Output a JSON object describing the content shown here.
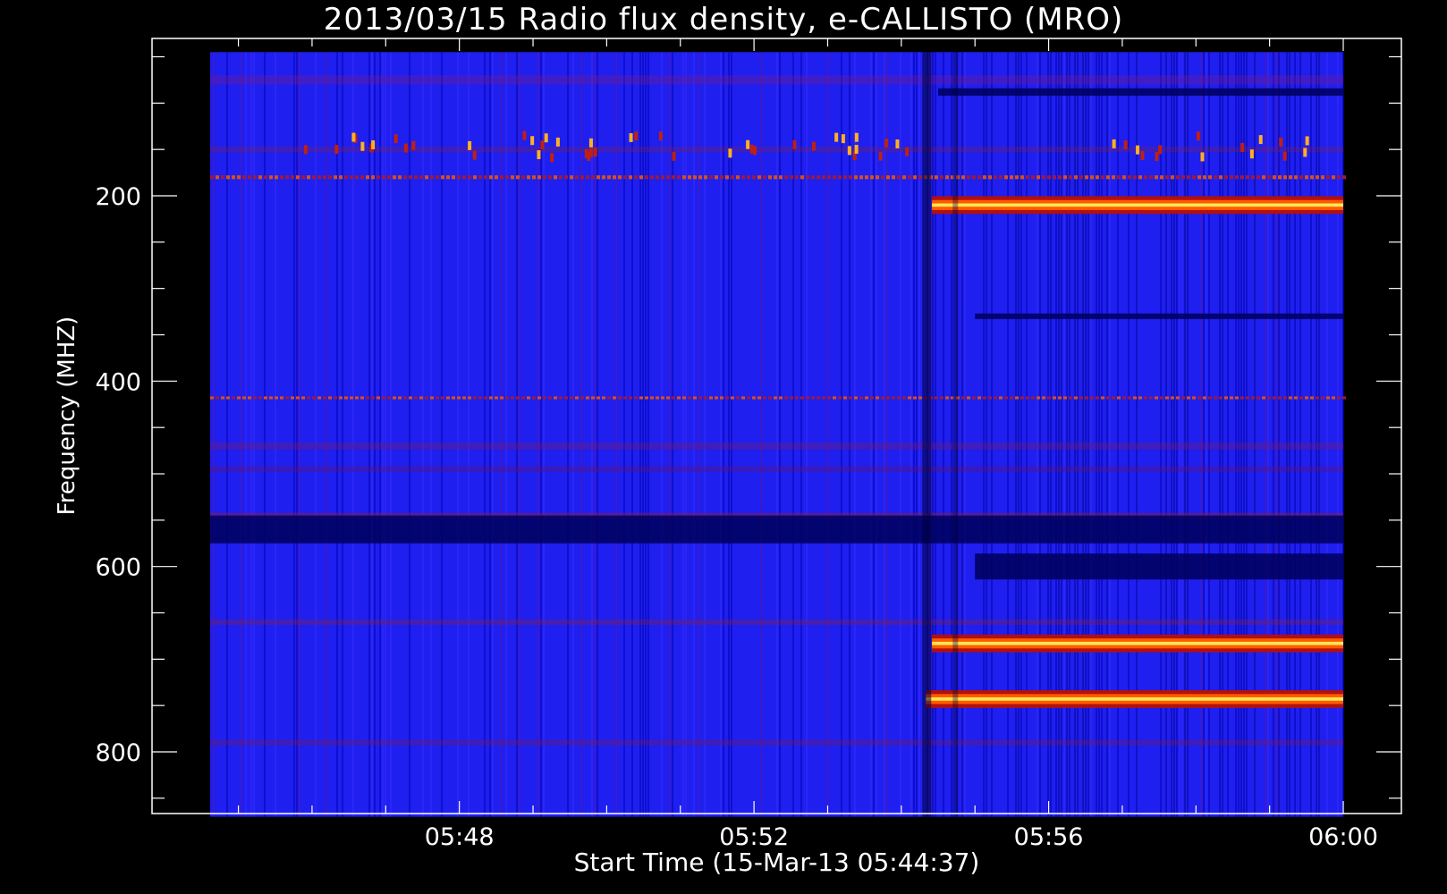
{
  "chart_data": {
    "type": "heatmap",
    "title": "2013/03/15  Radio flux density, e-CALLISTO (MRO)",
    "xlabel": "Start Time (15-Mar-13 05:44:37)",
    "ylabel": "Frequency (MHZ)",
    "x_ticks": [
      "05:48",
      "05:52",
      "05:56",
      "06:00"
    ],
    "y_ticks": [
      "200",
      "400",
      "600",
      "800"
    ],
    "xlim": [
      "05:44:37",
      "06:00:00"
    ],
    "ylim": [
      870,
      20
    ],
    "y_inverted": true,
    "data_extent_freq": [
      45,
      870
    ],
    "grid": false,
    "colormap": [
      "#000000",
      "#00007a",
      "#0000ff",
      "#5a0f9a",
      "#c01a10",
      "#ff5000",
      "#ffff60"
    ],
    "background_color": "#1f1ff0",
    "event_onset_time": "05:54:20",
    "features": [
      {
        "kind": "band",
        "freq": 210,
        "width": 12,
        "t_start": "05:54:25",
        "t_end": "06:00:00",
        "intensity": "high"
      },
      {
        "kind": "band",
        "freq": 683,
        "width": 12,
        "t_start": "05:54:25",
        "t_end": "06:00:00",
        "intensity": "high"
      },
      {
        "kind": "band",
        "freq": 743,
        "width": 12,
        "t_start": "05:54:20",
        "t_end": "06:00:00",
        "intensity": "high"
      },
      {
        "kind": "band",
        "freq": 180,
        "width": 4,
        "t_start": "05:44:37",
        "t_end": "06:00:00",
        "intensity": "medium"
      },
      {
        "kind": "band",
        "freq": 418,
        "width": 3,
        "t_start": "05:44:37",
        "t_end": "06:00:00",
        "intensity": "medium"
      },
      {
        "kind": "band",
        "freq": 88,
        "width": 8,
        "t_start": "05:54:30",
        "t_end": "06:00:00",
        "intensity": "dark"
      },
      {
        "kind": "band",
        "freq": 560,
        "width": 30,
        "t_start": "05:44:37",
        "t_end": "06:00:00",
        "intensity": "dark"
      },
      {
        "kind": "band",
        "freq": 600,
        "width": 28,
        "t_start": "05:55:00",
        "t_end": "06:00:00",
        "intensity": "dark"
      },
      {
        "kind": "band",
        "freq": 330,
        "width": 6,
        "t_start": "05:55:00",
        "t_end": "06:00:00",
        "intensity": "dark"
      }
    ]
  }
}
